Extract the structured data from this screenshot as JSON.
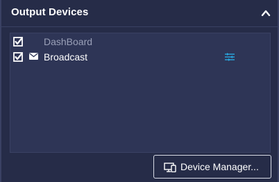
{
  "panel": {
    "title": "Output Devices",
    "collapse_icon": "chevron-up-icon"
  },
  "devices": [
    {
      "label": "DashBoard",
      "checked": true,
      "icon": "",
      "enabled": false
    },
    {
      "label": "Broadcast",
      "checked": true,
      "icon": "mail-icon",
      "settings_icon": "settings-sliders-icon",
      "enabled": true
    }
  ],
  "footer": {
    "device_manager_label": "Device Manager...",
    "device_manager_icon": "devices-icon"
  },
  "colors": {
    "background": "#262c48",
    "list_background": "#2e3556",
    "accent": "#29a8e0",
    "text": "#ffffff",
    "dim_text": "#9aa0b8"
  }
}
